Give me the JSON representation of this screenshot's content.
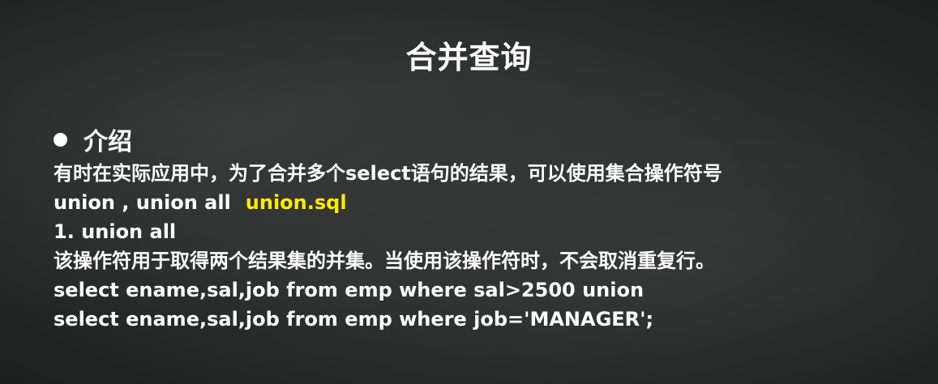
{
  "slide": {
    "title": "合并查询",
    "section_heading": "介绍",
    "lines": {
      "intro": "有时在实际应用中，为了合并多个select语句的结果，可以使用集合操作符号",
      "operators": "union , union all",
      "file_ref": "union.sql",
      "item_1": "1. union all",
      "desc": "该操作符用于取得两个结果集的并集。当使用该操作符时，不会取消重复行。",
      "sql_1": "select ename,sal,job from emp where sal>2500 union",
      "sql_2": "select ename,sal,job from emp where job='MANAGER';"
    },
    "colors": {
      "background": "#2e2f2f",
      "text": "#ffffff",
      "highlight": "#ffeb00"
    }
  }
}
